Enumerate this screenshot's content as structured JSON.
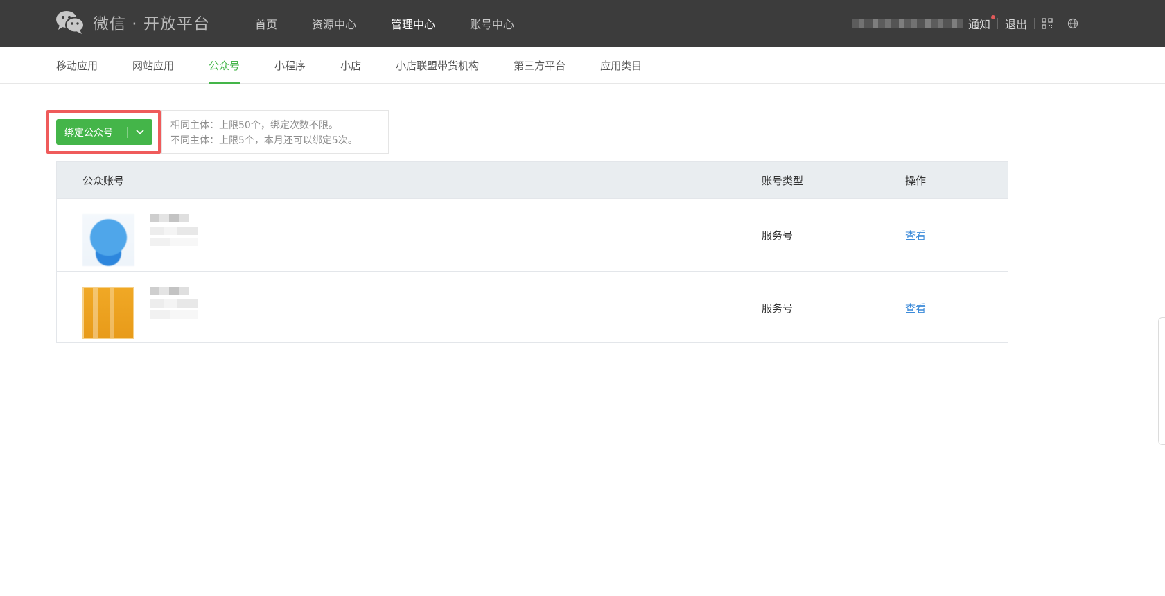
{
  "header": {
    "logo_text": "微信 · 开放平台",
    "nav": [
      {
        "label": "首页",
        "active": false
      },
      {
        "label": "资源中心",
        "active": false
      },
      {
        "label": "管理中心",
        "active": true
      },
      {
        "label": "账号中心",
        "active": false
      }
    ],
    "notify_label": "通知",
    "logout_label": "退出",
    "icons": [
      "wechat-logo-icon",
      "qrcode-icon",
      "globe-icon"
    ]
  },
  "subnav": [
    {
      "label": "移动应用",
      "active": false
    },
    {
      "label": "网站应用",
      "active": false
    },
    {
      "label": "公众号",
      "active": true
    },
    {
      "label": "小程序",
      "active": false
    },
    {
      "label": "小店",
      "active": false
    },
    {
      "label": "小店联盟带货机构",
      "active": false
    },
    {
      "label": "第三方平台",
      "active": false
    },
    {
      "label": "应用类目",
      "active": false
    }
  ],
  "bind": {
    "button_label": "绑定公众号",
    "tip_line1": "相同主体：上限50个，绑定次数不限。",
    "tip_line2": "不同主体：上限5个，本月还可以绑定5次。"
  },
  "table": {
    "headers": [
      "公众账号",
      "账号类型",
      "操作"
    ],
    "rows": [
      {
        "type": "服务号",
        "action": "查看",
        "avatar_color": "#4fa6ea"
      },
      {
        "type": "服务号",
        "action": "查看",
        "avatar_color": "#f0a825"
      }
    ]
  },
  "colors": {
    "topbar_bg": "#3c3c3c",
    "accent_green": "#44b549",
    "link_blue": "#3b8ad9",
    "highlight_red": "#ef5b5b"
  }
}
